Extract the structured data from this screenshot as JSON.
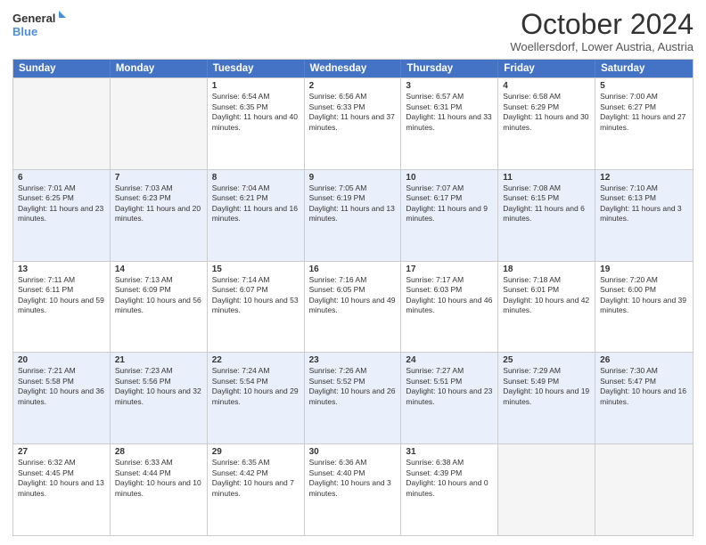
{
  "logo": {
    "line1": "General",
    "line2": "Blue"
  },
  "title": "October 2024",
  "subtitle": "Woellersdorf, Lower Austria, Austria",
  "days_of_week": [
    "Sunday",
    "Monday",
    "Tuesday",
    "Wednesday",
    "Thursday",
    "Friday",
    "Saturday"
  ],
  "weeks": [
    [
      {
        "day": "",
        "sunrise": "",
        "sunset": "",
        "daylight": "",
        "empty": true
      },
      {
        "day": "",
        "sunrise": "",
        "sunset": "",
        "daylight": "",
        "empty": true
      },
      {
        "day": "1",
        "sunrise": "Sunrise: 6:54 AM",
        "sunset": "Sunset: 6:35 PM",
        "daylight": "Daylight: 11 hours and 40 minutes.",
        "empty": false
      },
      {
        "day": "2",
        "sunrise": "Sunrise: 6:56 AM",
        "sunset": "Sunset: 6:33 PM",
        "daylight": "Daylight: 11 hours and 37 minutes.",
        "empty": false
      },
      {
        "day": "3",
        "sunrise": "Sunrise: 6:57 AM",
        "sunset": "Sunset: 6:31 PM",
        "daylight": "Daylight: 11 hours and 33 minutes.",
        "empty": false
      },
      {
        "day": "4",
        "sunrise": "Sunrise: 6:58 AM",
        "sunset": "Sunset: 6:29 PM",
        "daylight": "Daylight: 11 hours and 30 minutes.",
        "empty": false
      },
      {
        "day": "5",
        "sunrise": "Sunrise: 7:00 AM",
        "sunset": "Sunset: 6:27 PM",
        "daylight": "Daylight: 11 hours and 27 minutes.",
        "empty": false
      }
    ],
    [
      {
        "day": "6",
        "sunrise": "Sunrise: 7:01 AM",
        "sunset": "Sunset: 6:25 PM",
        "daylight": "Daylight: 11 hours and 23 minutes.",
        "empty": false
      },
      {
        "day": "7",
        "sunrise": "Sunrise: 7:03 AM",
        "sunset": "Sunset: 6:23 PM",
        "daylight": "Daylight: 11 hours and 20 minutes.",
        "empty": false
      },
      {
        "day": "8",
        "sunrise": "Sunrise: 7:04 AM",
        "sunset": "Sunset: 6:21 PM",
        "daylight": "Daylight: 11 hours and 16 minutes.",
        "empty": false
      },
      {
        "day": "9",
        "sunrise": "Sunrise: 7:05 AM",
        "sunset": "Sunset: 6:19 PM",
        "daylight": "Daylight: 11 hours and 13 minutes.",
        "empty": false
      },
      {
        "day": "10",
        "sunrise": "Sunrise: 7:07 AM",
        "sunset": "Sunset: 6:17 PM",
        "daylight": "Daylight: 11 hours and 9 minutes.",
        "empty": false
      },
      {
        "day": "11",
        "sunrise": "Sunrise: 7:08 AM",
        "sunset": "Sunset: 6:15 PM",
        "daylight": "Daylight: 11 hours and 6 minutes.",
        "empty": false
      },
      {
        "day": "12",
        "sunrise": "Sunrise: 7:10 AM",
        "sunset": "Sunset: 6:13 PM",
        "daylight": "Daylight: 11 hours and 3 minutes.",
        "empty": false
      }
    ],
    [
      {
        "day": "13",
        "sunrise": "Sunrise: 7:11 AM",
        "sunset": "Sunset: 6:11 PM",
        "daylight": "Daylight: 10 hours and 59 minutes.",
        "empty": false
      },
      {
        "day": "14",
        "sunrise": "Sunrise: 7:13 AM",
        "sunset": "Sunset: 6:09 PM",
        "daylight": "Daylight: 10 hours and 56 minutes.",
        "empty": false
      },
      {
        "day": "15",
        "sunrise": "Sunrise: 7:14 AM",
        "sunset": "Sunset: 6:07 PM",
        "daylight": "Daylight: 10 hours and 53 minutes.",
        "empty": false
      },
      {
        "day": "16",
        "sunrise": "Sunrise: 7:16 AM",
        "sunset": "Sunset: 6:05 PM",
        "daylight": "Daylight: 10 hours and 49 minutes.",
        "empty": false
      },
      {
        "day": "17",
        "sunrise": "Sunrise: 7:17 AM",
        "sunset": "Sunset: 6:03 PM",
        "daylight": "Daylight: 10 hours and 46 minutes.",
        "empty": false
      },
      {
        "day": "18",
        "sunrise": "Sunrise: 7:18 AM",
        "sunset": "Sunset: 6:01 PM",
        "daylight": "Daylight: 10 hours and 42 minutes.",
        "empty": false
      },
      {
        "day": "19",
        "sunrise": "Sunrise: 7:20 AM",
        "sunset": "Sunset: 6:00 PM",
        "daylight": "Daylight: 10 hours and 39 minutes.",
        "empty": false
      }
    ],
    [
      {
        "day": "20",
        "sunrise": "Sunrise: 7:21 AM",
        "sunset": "Sunset: 5:58 PM",
        "daylight": "Daylight: 10 hours and 36 minutes.",
        "empty": false
      },
      {
        "day": "21",
        "sunrise": "Sunrise: 7:23 AM",
        "sunset": "Sunset: 5:56 PM",
        "daylight": "Daylight: 10 hours and 32 minutes.",
        "empty": false
      },
      {
        "day": "22",
        "sunrise": "Sunrise: 7:24 AM",
        "sunset": "Sunset: 5:54 PM",
        "daylight": "Daylight: 10 hours and 29 minutes.",
        "empty": false
      },
      {
        "day": "23",
        "sunrise": "Sunrise: 7:26 AM",
        "sunset": "Sunset: 5:52 PM",
        "daylight": "Daylight: 10 hours and 26 minutes.",
        "empty": false
      },
      {
        "day": "24",
        "sunrise": "Sunrise: 7:27 AM",
        "sunset": "Sunset: 5:51 PM",
        "daylight": "Daylight: 10 hours and 23 minutes.",
        "empty": false
      },
      {
        "day": "25",
        "sunrise": "Sunrise: 7:29 AM",
        "sunset": "Sunset: 5:49 PM",
        "daylight": "Daylight: 10 hours and 19 minutes.",
        "empty": false
      },
      {
        "day": "26",
        "sunrise": "Sunrise: 7:30 AM",
        "sunset": "Sunset: 5:47 PM",
        "daylight": "Daylight: 10 hours and 16 minutes.",
        "empty": false
      }
    ],
    [
      {
        "day": "27",
        "sunrise": "Sunrise: 6:32 AM",
        "sunset": "Sunset: 4:45 PM",
        "daylight": "Daylight: 10 hours and 13 minutes.",
        "empty": false
      },
      {
        "day": "28",
        "sunrise": "Sunrise: 6:33 AM",
        "sunset": "Sunset: 4:44 PM",
        "daylight": "Daylight: 10 hours and 10 minutes.",
        "empty": false
      },
      {
        "day": "29",
        "sunrise": "Sunrise: 6:35 AM",
        "sunset": "Sunset: 4:42 PM",
        "daylight": "Daylight: 10 hours and 7 minutes.",
        "empty": false
      },
      {
        "day": "30",
        "sunrise": "Sunrise: 6:36 AM",
        "sunset": "Sunset: 4:40 PM",
        "daylight": "Daylight: 10 hours and 3 minutes.",
        "empty": false
      },
      {
        "day": "31",
        "sunrise": "Sunrise: 6:38 AM",
        "sunset": "Sunset: 4:39 PM",
        "daylight": "Daylight: 10 hours and 0 minutes.",
        "empty": false
      },
      {
        "day": "",
        "sunrise": "",
        "sunset": "",
        "daylight": "",
        "empty": true
      },
      {
        "day": "",
        "sunrise": "",
        "sunset": "",
        "daylight": "",
        "empty": true
      }
    ]
  ]
}
